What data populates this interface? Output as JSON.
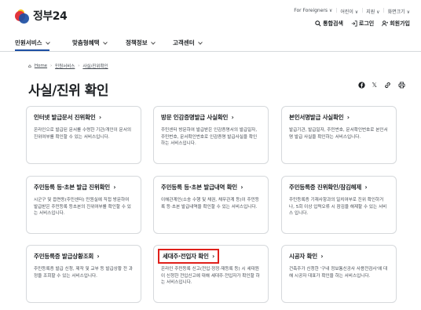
{
  "header": {
    "logo_text": "정부24",
    "utility_links": [
      "For Foreigners ∨",
      "어린이 ∨",
      "지원 ∨",
      "화면크기 ∨"
    ],
    "actions": [
      {
        "label": "통합검색",
        "icon": "search-icon"
      },
      {
        "label": "로그인",
        "icon": "login-icon"
      },
      {
        "label": "회원가입",
        "icon": "signup-icon"
      }
    ]
  },
  "nav": {
    "items": [
      "민원서비스",
      "맞춤형혜택",
      "정책정보",
      "고객센터"
    ]
  },
  "breadcrumb": {
    "home": "Home",
    "items": [
      "민원서비스",
      "사실/진위확인"
    ]
  },
  "page": {
    "title": "사실/진위 확인"
  },
  "share_icons": [
    "facebook-icon",
    "x-icon",
    "link-icon",
    "print-icon"
  ],
  "cards": [
    {
      "title": "인터넷 발급문서 진위확인",
      "desc": "온라인으로 발급된 문서를 수령한 기관/개인이 문서의 진위여부를 확인할 수 있는 서비스입니다."
    },
    {
      "title": "방문 인감증명발급 사실확인",
      "desc": "주민센터 방문하여 발급받은 인감증명서의 발급일자, 주민번호, 문서확인번호로 인감증명 발급사실을 확인하는 서비스입니다."
    },
    {
      "title": "본인서명발급 사실확인",
      "desc": "발급기관, 발급일자, 주민번호, 문서확인번호로 본인서명 발급 사실을 확인하는 서비스입니다."
    },
    {
      "title": "주민등록 등·초본 발급 진위확인",
      "desc": "시군구 및 읍면동(주민센터) 민원실에 직접 방문하여 발급받은 주민등록 등초본의 진위여부를 확인할 수 있는 서비스입니다."
    },
    {
      "title": "주민등록 등·초본 발급내역 확인",
      "desc": "이해관계인(소송 수행 및 채권, 채무관계 등)이 주민등록 등·초본 발급내역을 확인할 수 있는 서비스입니다."
    },
    {
      "title": "주민등록증 진위확인/잠김해제",
      "desc": "주민등록증 기재사항과의 일치여부로 진위 확인하거나, 5회 이상 입력오류 시 잠김을 해제할 수 있는 서비스 입니다."
    },
    {
      "title": "주민등록증 발급상황조회",
      "desc": "주민등록증 발급 신청, 제작 및 교부 등 발급상황 전 과정을 조회할 수 있는 서비스입니다."
    },
    {
      "title": "세대주·전입자 확인",
      "desc": "온라인 주민등록 신고(전입·정정·재등록 등) 시 세대원이 신청한 전입신고에 대해 세대주·전입자가 확인할 하는 서비스입니다.",
      "highlighted": true
    },
    {
      "title": "시공자 확인",
      "desc": "건축주가 신청한 '구내 정보통신공사 사용전검사'에 대해 시공자 대표가 확인을 하는 서비스입니다."
    }
  ],
  "colors": {
    "brand_blue": "#1d4fa3",
    "highlight_red": "#e0201b",
    "border": "#d6d9dc"
  }
}
